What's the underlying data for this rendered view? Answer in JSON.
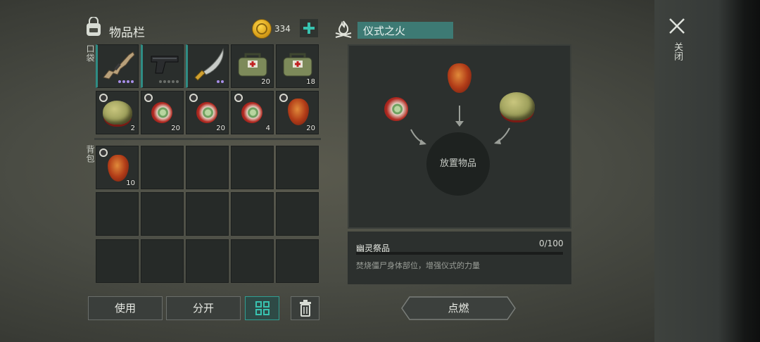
{
  "inventory": {
    "title": "物品栏",
    "pocket_label": "口袋",
    "backpack_label": "背包",
    "coins": "334",
    "pocket_items": [
      {
        "icon": "assault-rifle-icon",
        "count": "",
        "rarity": [
          "purple",
          "purple",
          "purple",
          "purple"
        ]
      },
      {
        "icon": "pistol-icon",
        "count": "",
        "rarity": [
          "grey",
          "grey",
          "grey",
          "grey",
          "grey"
        ]
      },
      {
        "icon": "machete-icon",
        "count": "",
        "rarity": [
          "purple",
          "purple"
        ]
      },
      {
        "icon": "medkit-bag-icon",
        "count": "20"
      },
      {
        "icon": "medkit-bag-icon",
        "count": "18"
      },
      {
        "icon": "brain-icon",
        "count": "2"
      },
      {
        "icon": "eyeball-icon",
        "count": "20"
      },
      {
        "icon": "eyeball-icon",
        "count": "20"
      },
      {
        "icon": "eyeball-icon",
        "count": "4"
      },
      {
        "icon": "heart-icon",
        "count": "20"
      }
    ],
    "backpack_items": [
      {
        "icon": "heart-icon",
        "count": "10"
      }
    ]
  },
  "buttons": {
    "use": "使用",
    "split": "分开",
    "ignite": "点燃",
    "close": "关闭"
  },
  "ritual": {
    "title": "仪式之火",
    "place_item": "放置物品",
    "offering_name": "幽灵祭品",
    "progress": "0/100",
    "progress_value": 0,
    "description": "焚烧僵尸身体部位，增强仪式的力量"
  },
  "colors": {
    "accent": "#3d7a74",
    "plus": "#38c3b0",
    "rarity_purple": "#a78ee8"
  }
}
